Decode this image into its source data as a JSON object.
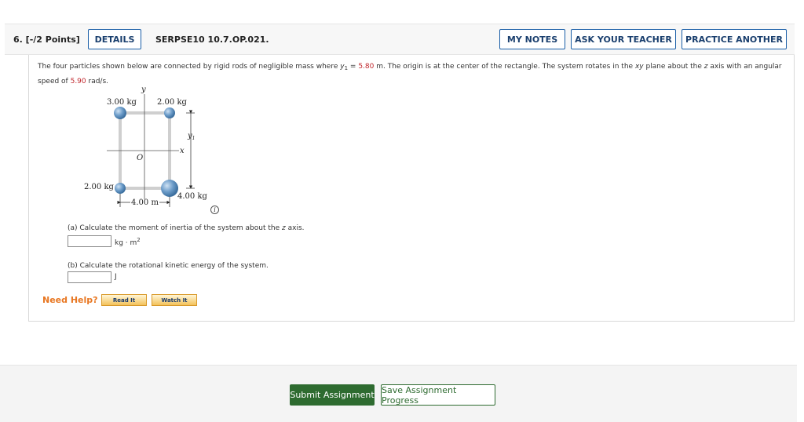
{
  "header": {
    "question_number": "6. [-/2 Points]",
    "details_label": "DETAILS",
    "question_code": "SERPSE10 10.7.OP.021.",
    "my_notes_label": "MY NOTES",
    "ask_teacher_label": "ASK YOUR TEACHER",
    "practice_label": "PRACTICE ANOTHER"
  },
  "prompt": {
    "part1": "The four particles shown below are connected by rigid rods of negligible mass where ",
    "var_letter": "y",
    "var_sub": "1",
    "equals": " = ",
    "y1_value": "5.80",
    "part2": " m. The origin is at the center of the rectangle. The system rotates in the ",
    "plane": "xy",
    "part3": " plane about the ",
    "axis": "z",
    "part4": " axis with an angular speed of ",
    "omega_value": "5.90",
    "part5": " rad/s."
  },
  "diagram": {
    "mass_top_left": "3.00 kg",
    "mass_top_right": "2.00 kg",
    "mass_bottom_left": "2.00 kg",
    "mass_bottom_right": "4.00 kg",
    "axis_y": "y",
    "axis_x": "x",
    "origin": "O",
    "y1_label": "y",
    "y1_sub": "1",
    "width_label": "4.00 m",
    "info_glyph": "i"
  },
  "part_a": {
    "text_before": "(a) Calculate the moment of inertia of the system about the ",
    "axis": "z",
    "text_after": " axis.",
    "value": "",
    "unit": "kg · m",
    "unit_exp": "2"
  },
  "part_b": {
    "text": "(b) Calculate the rotational kinetic energy of the system.",
    "value": "",
    "unit": "J"
  },
  "help": {
    "label": "Need Help?",
    "read_it": "Read It",
    "watch_it": "Watch It"
  },
  "footer": {
    "submit_label": "Submit Assignment",
    "save_label": "Save Assignment Progress"
  },
  "colors": {
    "accent_blue": "#1a5ea7",
    "value_red": "#c0272d",
    "help_orange": "#e87722",
    "submit_green": "#2e6b30"
  }
}
